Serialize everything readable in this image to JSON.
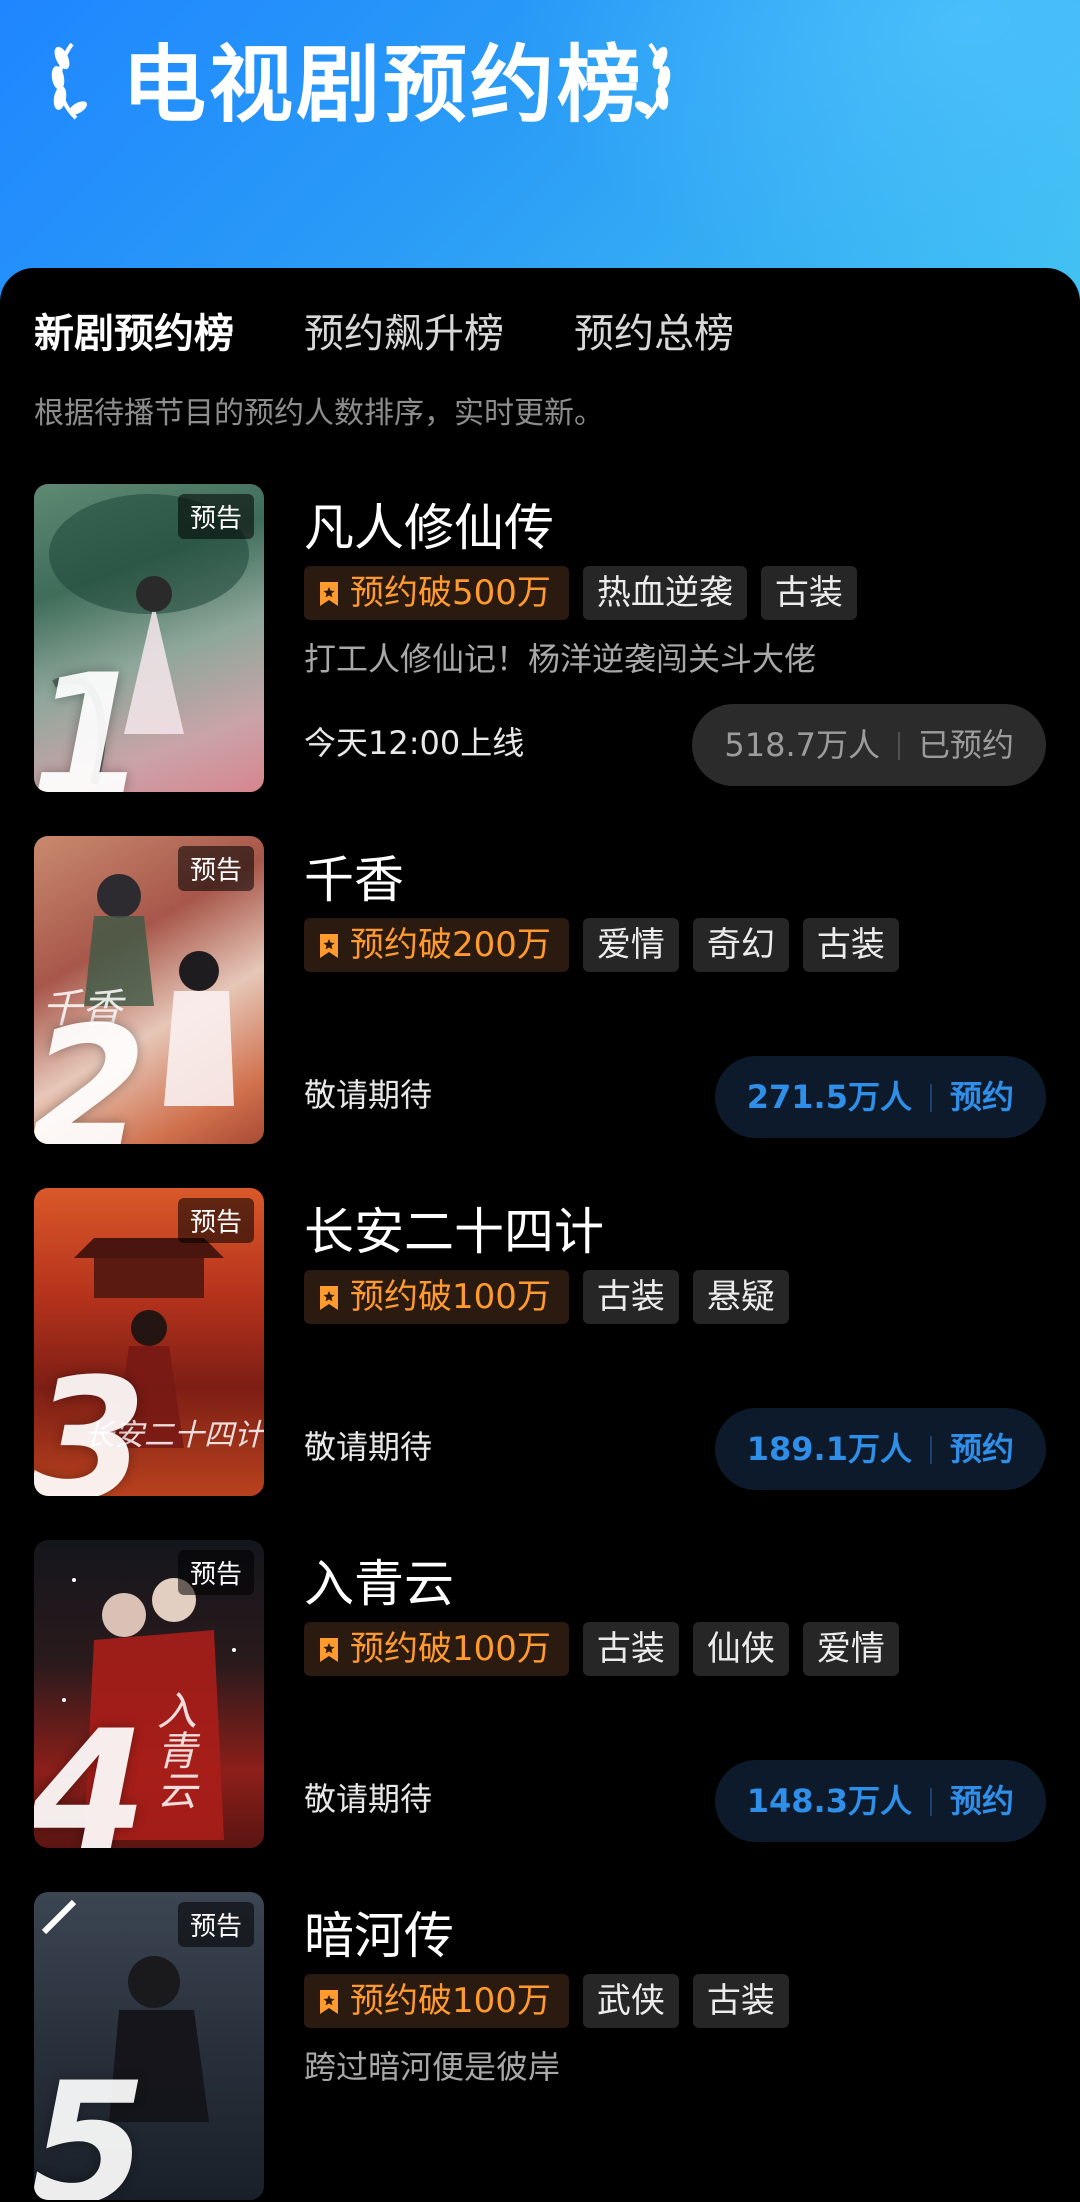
{
  "header": {
    "title": "电视剧预约榜"
  },
  "tabs": [
    {
      "label": "新剧预约榜",
      "active": true
    },
    {
      "label": "预约飙升榜",
      "active": false
    },
    {
      "label": "预约总榜",
      "active": false
    }
  ],
  "subtitle": "根据待播节目的预约人数排序，实时更新。",
  "trailer_label": "预告",
  "items": [
    {
      "rank": "1",
      "title": "凡人修仙传",
      "badge": "预约破500万",
      "tags": [
        "热血逆袭",
        "古装"
      ],
      "desc": "打工人修仙记！杨洋逆袭闯关斗大佬",
      "status": "今天12:00上线",
      "count": "518.7万人",
      "action": "已预约",
      "reserved": true
    },
    {
      "rank": "2",
      "title": "千香",
      "badge": "预约破200万",
      "tags": [
        "爱情",
        "奇幻",
        "古装"
      ],
      "desc": "",
      "status": "敬请期待",
      "count": "271.5万人",
      "action": "预约",
      "reserved": false
    },
    {
      "rank": "3",
      "title": "长安二十四计",
      "badge": "预约破100万",
      "tags": [
        "古装",
        "悬疑"
      ],
      "desc": "",
      "status": "敬请期待",
      "count": "189.1万人",
      "action": "预约",
      "reserved": false
    },
    {
      "rank": "4",
      "title": "入青云",
      "badge": "预约破100万",
      "tags": [
        "古装",
        "仙侠",
        "爱情"
      ],
      "desc": "",
      "status": "敬请期待",
      "count": "148.3万人",
      "action": "预约",
      "reserved": false
    },
    {
      "rank": "5",
      "title": "暗河传",
      "badge": "预约破100万",
      "tags": [
        "武侠",
        "古装"
      ],
      "desc": "跨过暗河便是彼岸",
      "status": "",
      "count": "",
      "action": "",
      "reserved": false
    }
  ],
  "colors": {
    "accent": "#2f8fe8",
    "badge": "#ff9a2e",
    "hero_start": "#1f86ff",
    "hero_end": "#43c3f2"
  },
  "icons": {
    "laurel_left": "laurel-left-icon",
    "laurel_right": "laurel-right-icon",
    "bookmark": "bookmark-icon"
  }
}
